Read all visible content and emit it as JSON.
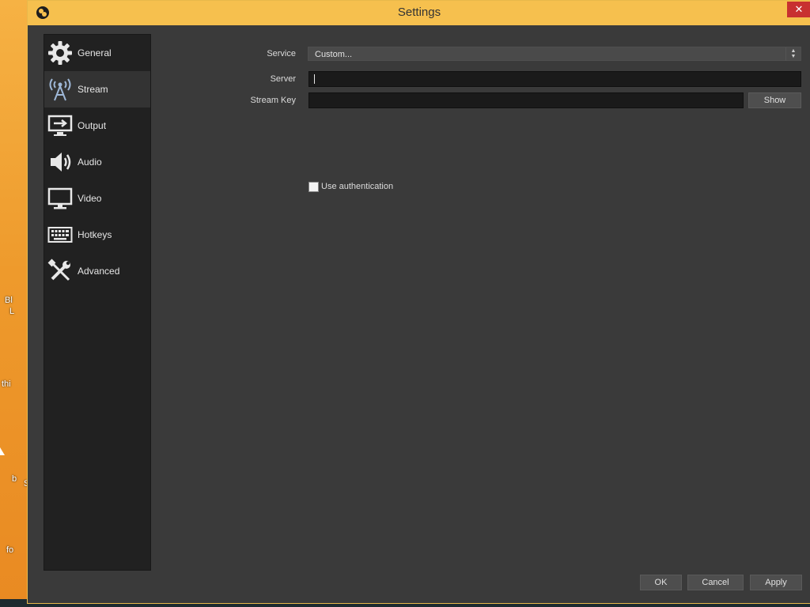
{
  "window": {
    "title": "Settings",
    "close_symbol": "✕",
    "app_icon": "obs-logo-icon"
  },
  "desktop": {
    "texts": [
      "Bl",
      "L",
      "thi",
      "b",
      "S",
      "fo"
    ]
  },
  "sidebar": {
    "items": [
      {
        "label": "General",
        "icon": "gear-icon",
        "active": false
      },
      {
        "label": "Stream",
        "icon": "broadcast-tower-icon",
        "active": true
      },
      {
        "label": "Output",
        "icon": "output-monitor-icon",
        "active": false
      },
      {
        "label": "Audio",
        "icon": "speaker-icon",
        "active": false
      },
      {
        "label": "Video",
        "icon": "monitor-icon",
        "active": false
      },
      {
        "label": "Hotkeys",
        "icon": "keyboard-icon",
        "active": false
      },
      {
        "label": "Advanced",
        "icon": "tools-icon",
        "active": false
      }
    ]
  },
  "stream": {
    "service_label": "Service",
    "service_value": "Custom...",
    "server_label": "Server",
    "server_value": "",
    "stream_key_label": "Stream Key",
    "stream_key_value": "",
    "show_button": "Show",
    "use_auth_label": "Use authentication",
    "use_auth_checked": false
  },
  "footer": {
    "ok": "OK",
    "cancel": "Cancel",
    "apply": "Apply"
  },
  "colors": {
    "title_bar": "#f6c04e",
    "window_bg": "#3a3a3a",
    "sidebar_bg": "#212121",
    "close_button": "#c83030"
  }
}
